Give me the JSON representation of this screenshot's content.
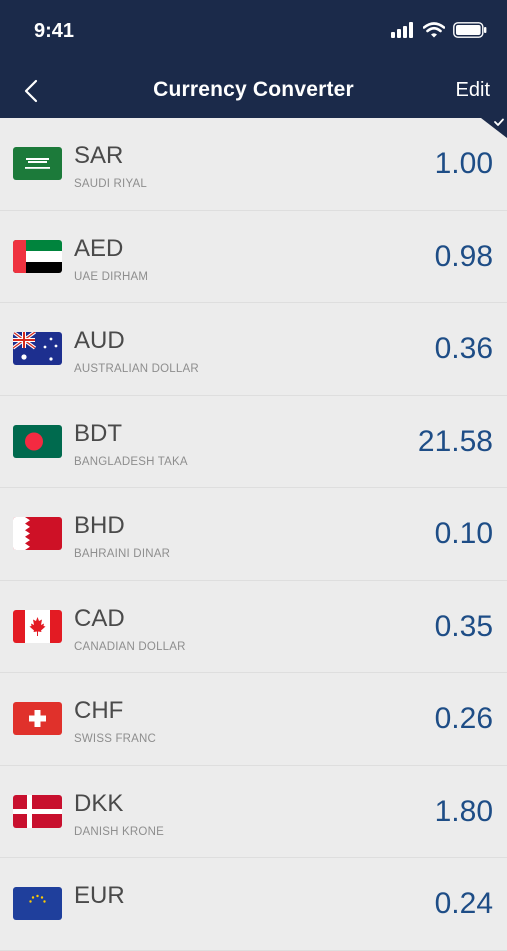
{
  "status_bar": {
    "time": "9:41"
  },
  "nav": {
    "title": "Currency Converter",
    "edit_label": "Edit"
  },
  "currencies": [
    {
      "code": "SAR",
      "name": "SAUDI RIYAL",
      "value": "1.00"
    },
    {
      "code": "AED",
      "name": "UAE DIRHAM",
      "value": "0.98"
    },
    {
      "code": "AUD",
      "name": "AUSTRALIAN DOLLAR",
      "value": "0.36"
    },
    {
      "code": "BDT",
      "name": "BANGLADESH TAKA",
      "value": "21.58"
    },
    {
      "code": "BHD",
      "name": "BAHRAINI DINAR",
      "value": "0.10"
    },
    {
      "code": "CAD",
      "name": "CANADIAN DOLLAR",
      "value": "0.35"
    },
    {
      "code": "CHF",
      "name": "SWISS FRANC",
      "value": "0.26"
    },
    {
      "code": "DKK",
      "name": "DANISH KRONE",
      "value": "1.80"
    },
    {
      "code": "EUR",
      "name": "",
      "value": "0.24"
    }
  ],
  "colors": {
    "header": "#1b2a4a",
    "value_text": "#1e4d86",
    "background": "#ececec"
  }
}
